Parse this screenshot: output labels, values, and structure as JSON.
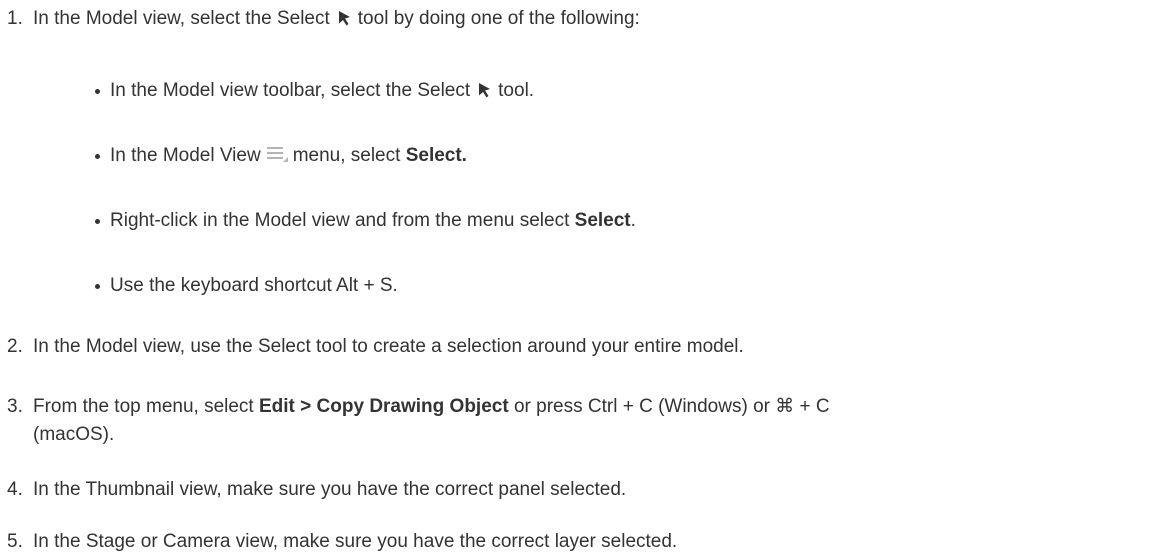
{
  "steps": [
    {
      "number": "1.",
      "before": "In the Model view, select the Select",
      "after": "tool by doing one of the following:",
      "icon": "select-arrow-icon",
      "sub_bullets": [
        {
          "before": "In the Model view toolbar, select the Select",
          "icon": "select-arrow-icon",
          "after": "tool."
        },
        {
          "before": "In the Model View",
          "icon": "hamburger-menu-icon",
          "after": "menu, select",
          "bold": "Select.",
          "tail": ""
        },
        {
          "before": "Right-click in the Model view and from the menu select",
          "bold": "Select",
          "tail": "."
        },
        {
          "before": "Use the keyboard shortcut Alt + S."
        }
      ]
    },
    {
      "number": "2.",
      "text": "In the Model view, use the Select tool to create a selection around your entire model."
    },
    {
      "number": "3.",
      "before": "From the top menu, select",
      "bold": "Edit > Copy Drawing Object",
      "after": "or press Ctrl + C (Windows) or ⌘ + C",
      "line2": "(macOS)."
    },
    {
      "number": "4.",
      "text": "In the Thumbnail view, make sure you have the correct panel selected."
    },
    {
      "number": "5.",
      "text": "In the Stage or Camera view, make sure you have the correct layer selected."
    }
  ],
  "colors": {
    "text": "#333333",
    "icon": "#333333",
    "menu_icon": "#b5b5b5"
  }
}
